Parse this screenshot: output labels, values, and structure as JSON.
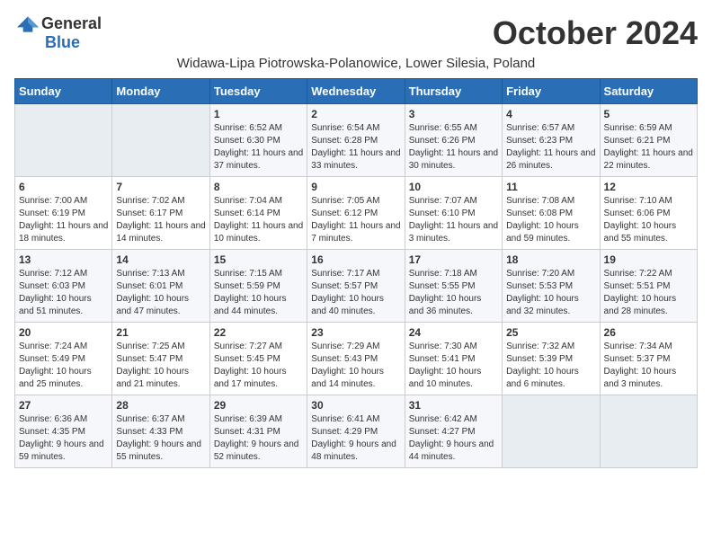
{
  "logo": {
    "general": "General",
    "blue": "Blue"
  },
  "title": "October 2024",
  "subtitle": "Widawa-Lipa Piotrowska-Polanowice, Lower Silesia, Poland",
  "days_header": [
    "Sunday",
    "Monday",
    "Tuesday",
    "Wednesday",
    "Thursday",
    "Friday",
    "Saturday"
  ],
  "weeks": [
    [
      {
        "day": "",
        "sunrise": "",
        "sunset": "",
        "daylight": ""
      },
      {
        "day": "",
        "sunrise": "",
        "sunset": "",
        "daylight": ""
      },
      {
        "day": "1",
        "sunrise": "Sunrise: 6:52 AM",
        "sunset": "Sunset: 6:30 PM",
        "daylight": "Daylight: 11 hours and 37 minutes."
      },
      {
        "day": "2",
        "sunrise": "Sunrise: 6:54 AM",
        "sunset": "Sunset: 6:28 PM",
        "daylight": "Daylight: 11 hours and 33 minutes."
      },
      {
        "day": "3",
        "sunrise": "Sunrise: 6:55 AM",
        "sunset": "Sunset: 6:26 PM",
        "daylight": "Daylight: 11 hours and 30 minutes."
      },
      {
        "day": "4",
        "sunrise": "Sunrise: 6:57 AM",
        "sunset": "Sunset: 6:23 PM",
        "daylight": "Daylight: 11 hours and 26 minutes."
      },
      {
        "day": "5",
        "sunrise": "Sunrise: 6:59 AM",
        "sunset": "Sunset: 6:21 PM",
        "daylight": "Daylight: 11 hours and 22 minutes."
      }
    ],
    [
      {
        "day": "6",
        "sunrise": "Sunrise: 7:00 AM",
        "sunset": "Sunset: 6:19 PM",
        "daylight": "Daylight: 11 hours and 18 minutes."
      },
      {
        "day": "7",
        "sunrise": "Sunrise: 7:02 AM",
        "sunset": "Sunset: 6:17 PM",
        "daylight": "Daylight: 11 hours and 14 minutes."
      },
      {
        "day": "8",
        "sunrise": "Sunrise: 7:04 AM",
        "sunset": "Sunset: 6:14 PM",
        "daylight": "Daylight: 11 hours and 10 minutes."
      },
      {
        "day": "9",
        "sunrise": "Sunrise: 7:05 AM",
        "sunset": "Sunset: 6:12 PM",
        "daylight": "Daylight: 11 hours and 7 minutes."
      },
      {
        "day": "10",
        "sunrise": "Sunrise: 7:07 AM",
        "sunset": "Sunset: 6:10 PM",
        "daylight": "Daylight: 11 hours and 3 minutes."
      },
      {
        "day": "11",
        "sunrise": "Sunrise: 7:08 AM",
        "sunset": "Sunset: 6:08 PM",
        "daylight": "Daylight: 10 hours and 59 minutes."
      },
      {
        "day": "12",
        "sunrise": "Sunrise: 7:10 AM",
        "sunset": "Sunset: 6:06 PM",
        "daylight": "Daylight: 10 hours and 55 minutes."
      }
    ],
    [
      {
        "day": "13",
        "sunrise": "Sunrise: 7:12 AM",
        "sunset": "Sunset: 6:03 PM",
        "daylight": "Daylight: 10 hours and 51 minutes."
      },
      {
        "day": "14",
        "sunrise": "Sunrise: 7:13 AM",
        "sunset": "Sunset: 6:01 PM",
        "daylight": "Daylight: 10 hours and 47 minutes."
      },
      {
        "day": "15",
        "sunrise": "Sunrise: 7:15 AM",
        "sunset": "Sunset: 5:59 PM",
        "daylight": "Daylight: 10 hours and 44 minutes."
      },
      {
        "day": "16",
        "sunrise": "Sunrise: 7:17 AM",
        "sunset": "Sunset: 5:57 PM",
        "daylight": "Daylight: 10 hours and 40 minutes."
      },
      {
        "day": "17",
        "sunrise": "Sunrise: 7:18 AM",
        "sunset": "Sunset: 5:55 PM",
        "daylight": "Daylight: 10 hours and 36 minutes."
      },
      {
        "day": "18",
        "sunrise": "Sunrise: 7:20 AM",
        "sunset": "Sunset: 5:53 PM",
        "daylight": "Daylight: 10 hours and 32 minutes."
      },
      {
        "day": "19",
        "sunrise": "Sunrise: 7:22 AM",
        "sunset": "Sunset: 5:51 PM",
        "daylight": "Daylight: 10 hours and 28 minutes."
      }
    ],
    [
      {
        "day": "20",
        "sunrise": "Sunrise: 7:24 AM",
        "sunset": "Sunset: 5:49 PM",
        "daylight": "Daylight: 10 hours and 25 minutes."
      },
      {
        "day": "21",
        "sunrise": "Sunrise: 7:25 AM",
        "sunset": "Sunset: 5:47 PM",
        "daylight": "Daylight: 10 hours and 21 minutes."
      },
      {
        "day": "22",
        "sunrise": "Sunrise: 7:27 AM",
        "sunset": "Sunset: 5:45 PM",
        "daylight": "Daylight: 10 hours and 17 minutes."
      },
      {
        "day": "23",
        "sunrise": "Sunrise: 7:29 AM",
        "sunset": "Sunset: 5:43 PM",
        "daylight": "Daylight: 10 hours and 14 minutes."
      },
      {
        "day": "24",
        "sunrise": "Sunrise: 7:30 AM",
        "sunset": "Sunset: 5:41 PM",
        "daylight": "Daylight: 10 hours and 10 minutes."
      },
      {
        "day": "25",
        "sunrise": "Sunrise: 7:32 AM",
        "sunset": "Sunset: 5:39 PM",
        "daylight": "Daylight: 10 hours and 6 minutes."
      },
      {
        "day": "26",
        "sunrise": "Sunrise: 7:34 AM",
        "sunset": "Sunset: 5:37 PM",
        "daylight": "Daylight: 10 hours and 3 minutes."
      }
    ],
    [
      {
        "day": "27",
        "sunrise": "Sunrise: 6:36 AM",
        "sunset": "Sunset: 4:35 PM",
        "daylight": "Daylight: 9 hours and 59 minutes."
      },
      {
        "day": "28",
        "sunrise": "Sunrise: 6:37 AM",
        "sunset": "Sunset: 4:33 PM",
        "daylight": "Daylight: 9 hours and 55 minutes."
      },
      {
        "day": "29",
        "sunrise": "Sunrise: 6:39 AM",
        "sunset": "Sunset: 4:31 PM",
        "daylight": "Daylight: 9 hours and 52 minutes."
      },
      {
        "day": "30",
        "sunrise": "Sunrise: 6:41 AM",
        "sunset": "Sunset: 4:29 PM",
        "daylight": "Daylight: 9 hours and 48 minutes."
      },
      {
        "day": "31",
        "sunrise": "Sunrise: 6:42 AM",
        "sunset": "Sunset: 4:27 PM",
        "daylight": "Daylight: 9 hours and 44 minutes."
      },
      {
        "day": "",
        "sunrise": "",
        "sunset": "",
        "daylight": ""
      },
      {
        "day": "",
        "sunrise": "",
        "sunset": "",
        "daylight": ""
      }
    ]
  ]
}
